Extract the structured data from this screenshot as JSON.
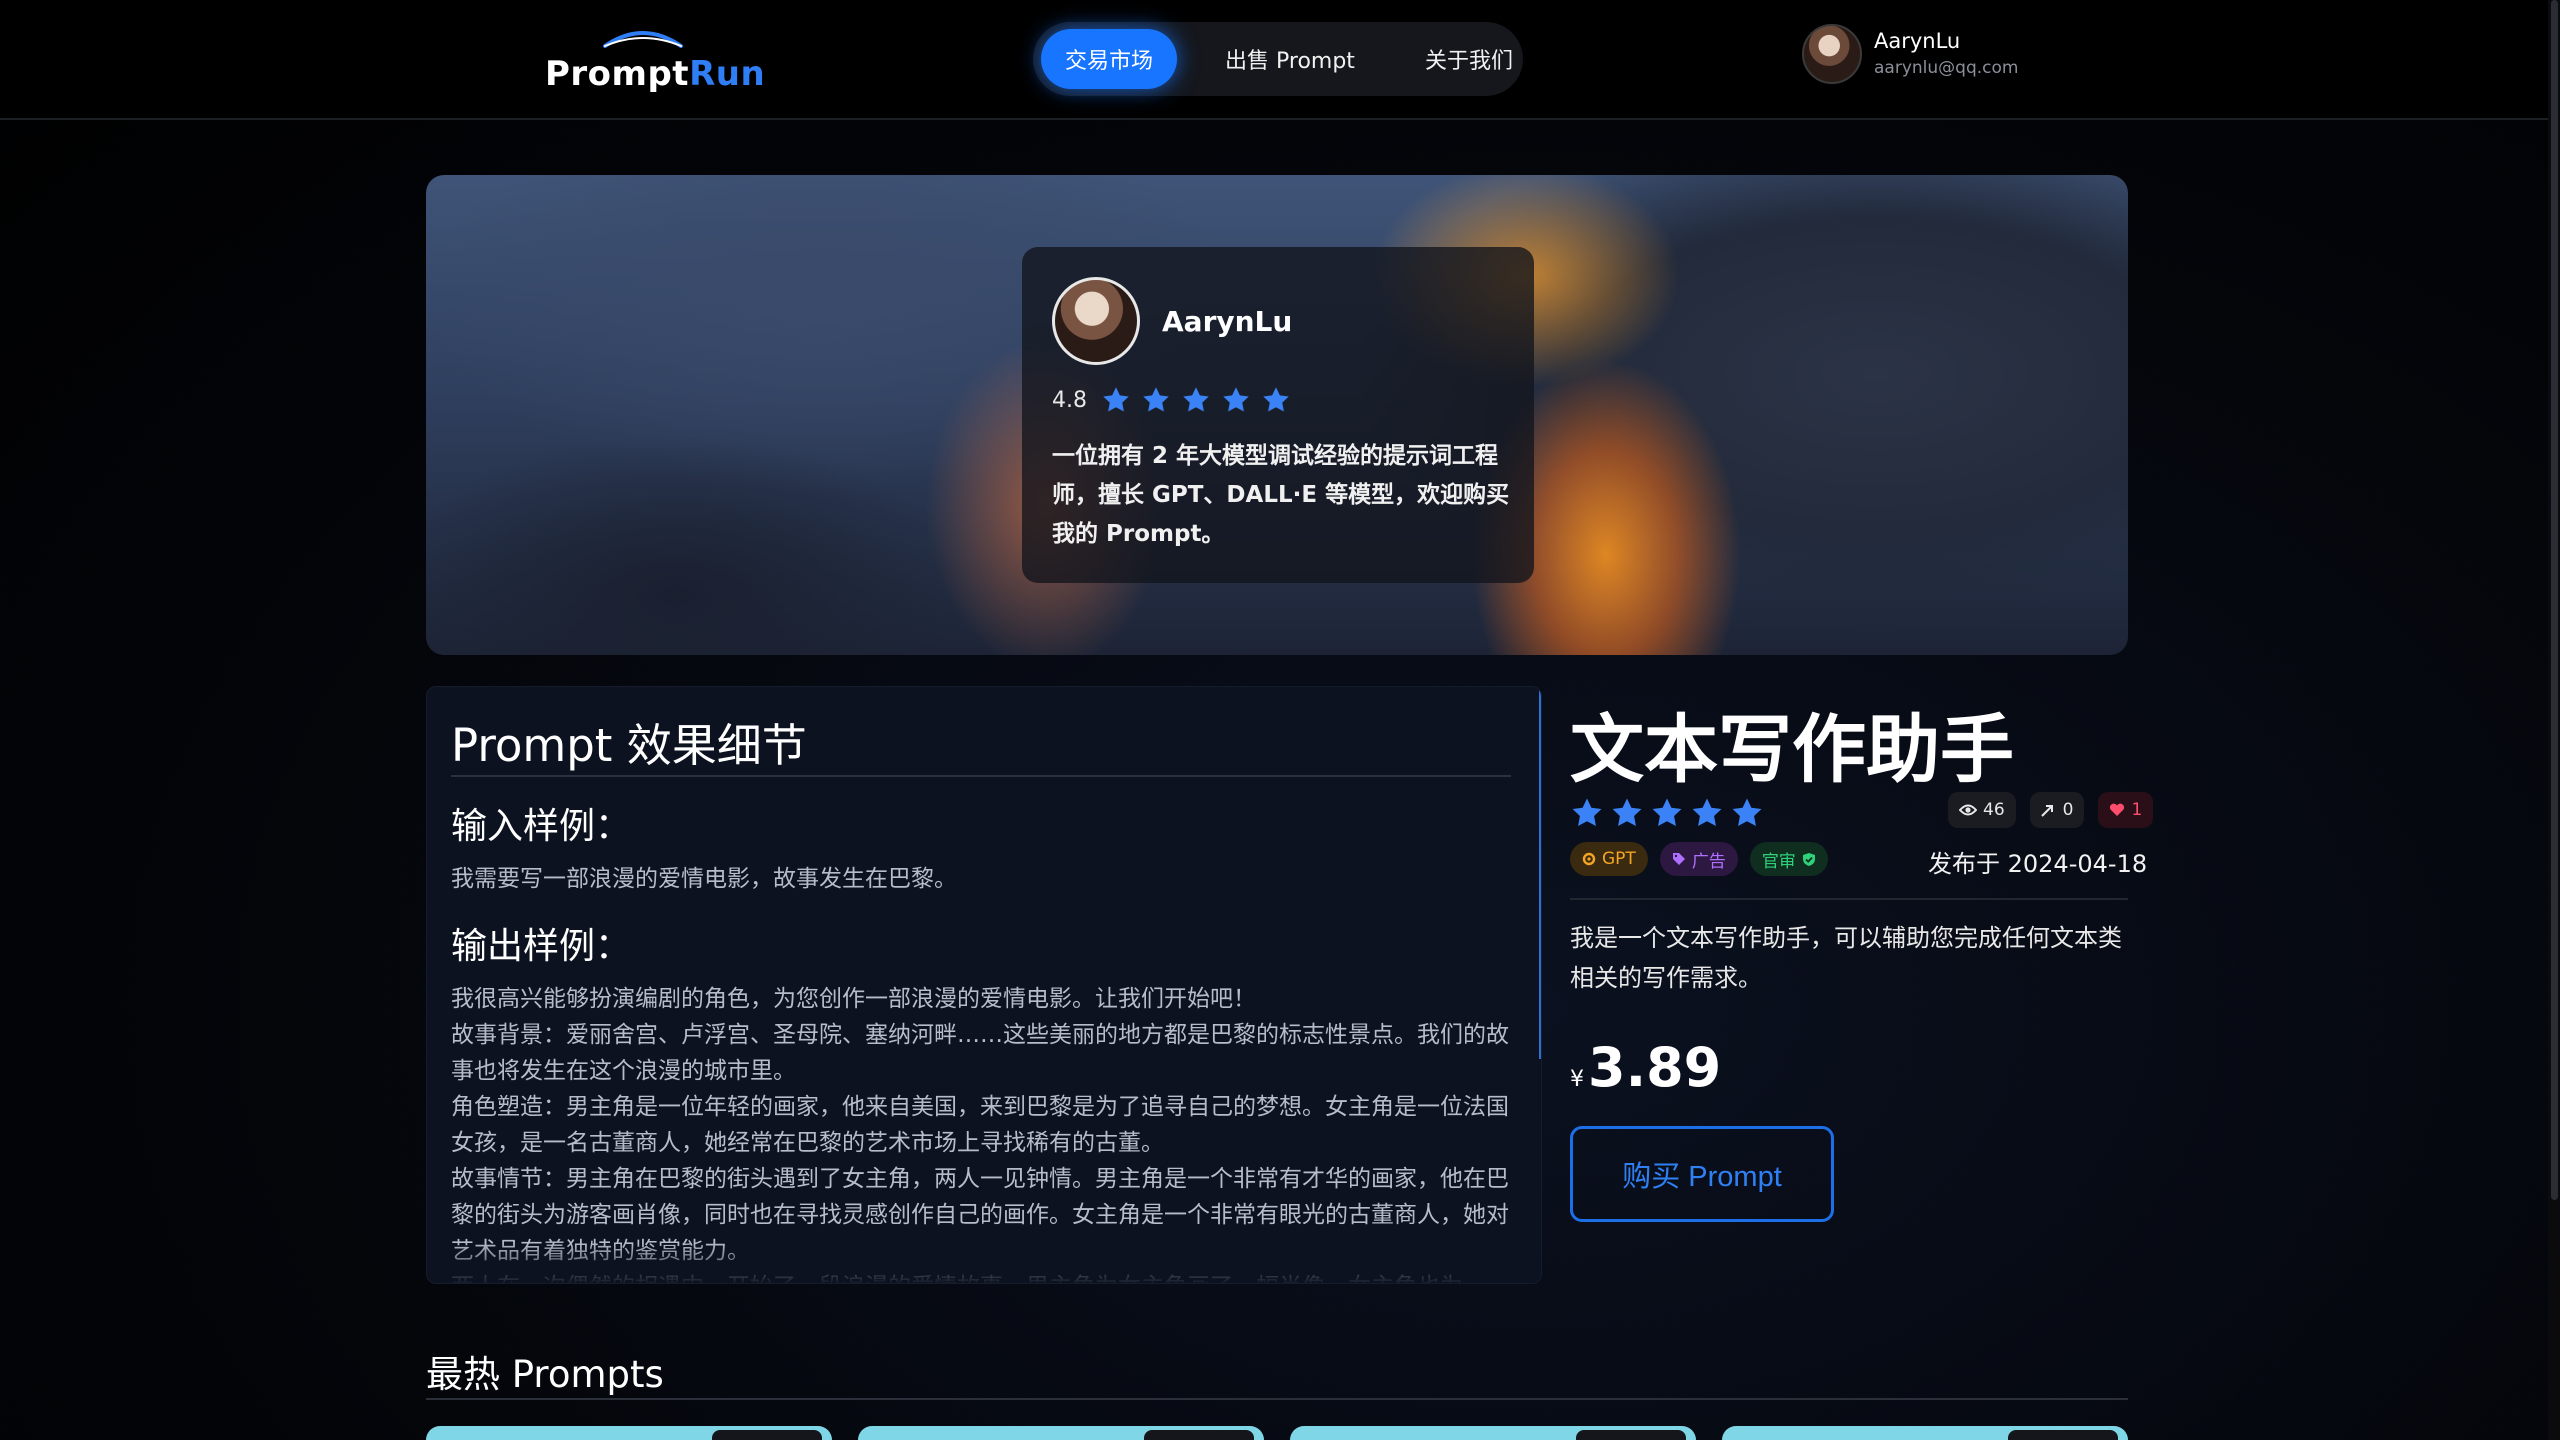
{
  "nav": {
    "logo_prefix": "Prompt",
    "logo_suffix": "Run",
    "items": [
      {
        "label": "交易市场",
        "active": true
      },
      {
        "label": "出售 Prompt",
        "active": false
      },
      {
        "label": "关于我们",
        "active": false
      }
    ],
    "user": {
      "name": "AarynLu",
      "email": "aarynlu@qq.com"
    }
  },
  "seller": {
    "name": "AarynLu",
    "rating": "4.8",
    "stars": 5,
    "bio": "一位拥有 2 年大模型调试经验的提示词工程师，擅长 GPT、DALL·E 等模型，欢迎购买我的 Prompt。"
  },
  "detail": {
    "title": "Prompt 效果细节",
    "input_heading": "输入样例：",
    "input_text": "我需要写一部浪漫的爱情电影，故事发生在巴黎。",
    "output_heading": "输出样例：",
    "output_lines": [
      "我很高兴能够扮演编剧的角色，为您创作一部浪漫的爱情电影。让我们开始吧！",
      "故事背景：爱丽舍宫、卢浮宫、圣母院、塞纳河畔……这些美丽的地方都是巴黎的标志性景点。我们的故事也将发生在这个浪漫的城市里。",
      "角色塑造：男主角是一位年轻的画家，他来自美国，来到巴黎是为了追寻自己的梦想。女主角是一位法国女孩，是一名古董商人，她经常在巴黎的艺术市场上寻找稀有的古董。",
      "故事情节：男主角在巴黎的街头遇到了女主角，两人一见钟情。男主角是一个非常有才华的画家，他在巴黎的街头为游客画肖像，同时也在寻找灵感创作自己的画作。女主角是一个非常有眼光的古董商人，她对艺术品有着独特的鉴赏能力。",
      "两人在一次偶然的相遇中，开始了一段浪漫的爱情故事。男主角为女主角画了一幅肖像，女主角也为"
    ]
  },
  "product": {
    "title": "文本写作助手",
    "stars": 5,
    "views": "46",
    "shares": "0",
    "likes": "1",
    "tags": {
      "gpt": "GPT",
      "ad": "广告",
      "audit": "官审"
    },
    "published": "发布于 2024-04-18",
    "description": "我是一个文本写作助手，可以辅助您完成任何文本类相关的写作需求。",
    "currency": "¥",
    "price": "3.89",
    "buy_label": "购买 Prompt"
  },
  "hot": {
    "title": "最热 Prompts"
  },
  "colors": {
    "accent": "#1875ff",
    "star": "#3b82f6",
    "background": "#000000"
  }
}
